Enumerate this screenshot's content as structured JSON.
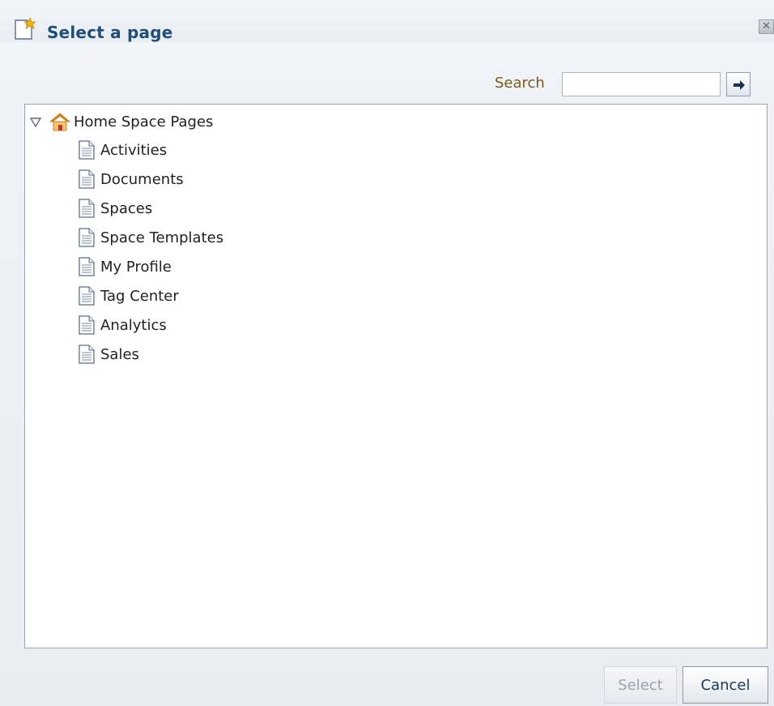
{
  "dialog": {
    "title": "Select a page",
    "close_glyph": "✕"
  },
  "search": {
    "label": "Search",
    "value": "",
    "placeholder": ""
  },
  "tree": {
    "root": {
      "label": "Home Space Pages",
      "expanded": true,
      "icon": "home-icon"
    },
    "items": [
      {
        "label": "Activities",
        "icon": "page-icon"
      },
      {
        "label": "Documents",
        "icon": "page-icon"
      },
      {
        "label": "Spaces",
        "icon": "page-icon"
      },
      {
        "label": "Space Templates",
        "icon": "page-icon"
      },
      {
        "label": "My Profile",
        "icon": "page-icon"
      },
      {
        "label": "Tag Center",
        "icon": "page-icon"
      },
      {
        "label": "Analytics",
        "icon": "page-icon"
      },
      {
        "label": "Sales",
        "icon": "page-icon"
      }
    ]
  },
  "buttons": {
    "select_label": "Select",
    "select_enabled": false,
    "cancel_label": "Cancel"
  },
  "colors": {
    "title_text": "#1f4e79",
    "search_label": "#7a5a1a",
    "home_roof": "#e58a17",
    "page_icon_outline": "#5b6f8c"
  }
}
